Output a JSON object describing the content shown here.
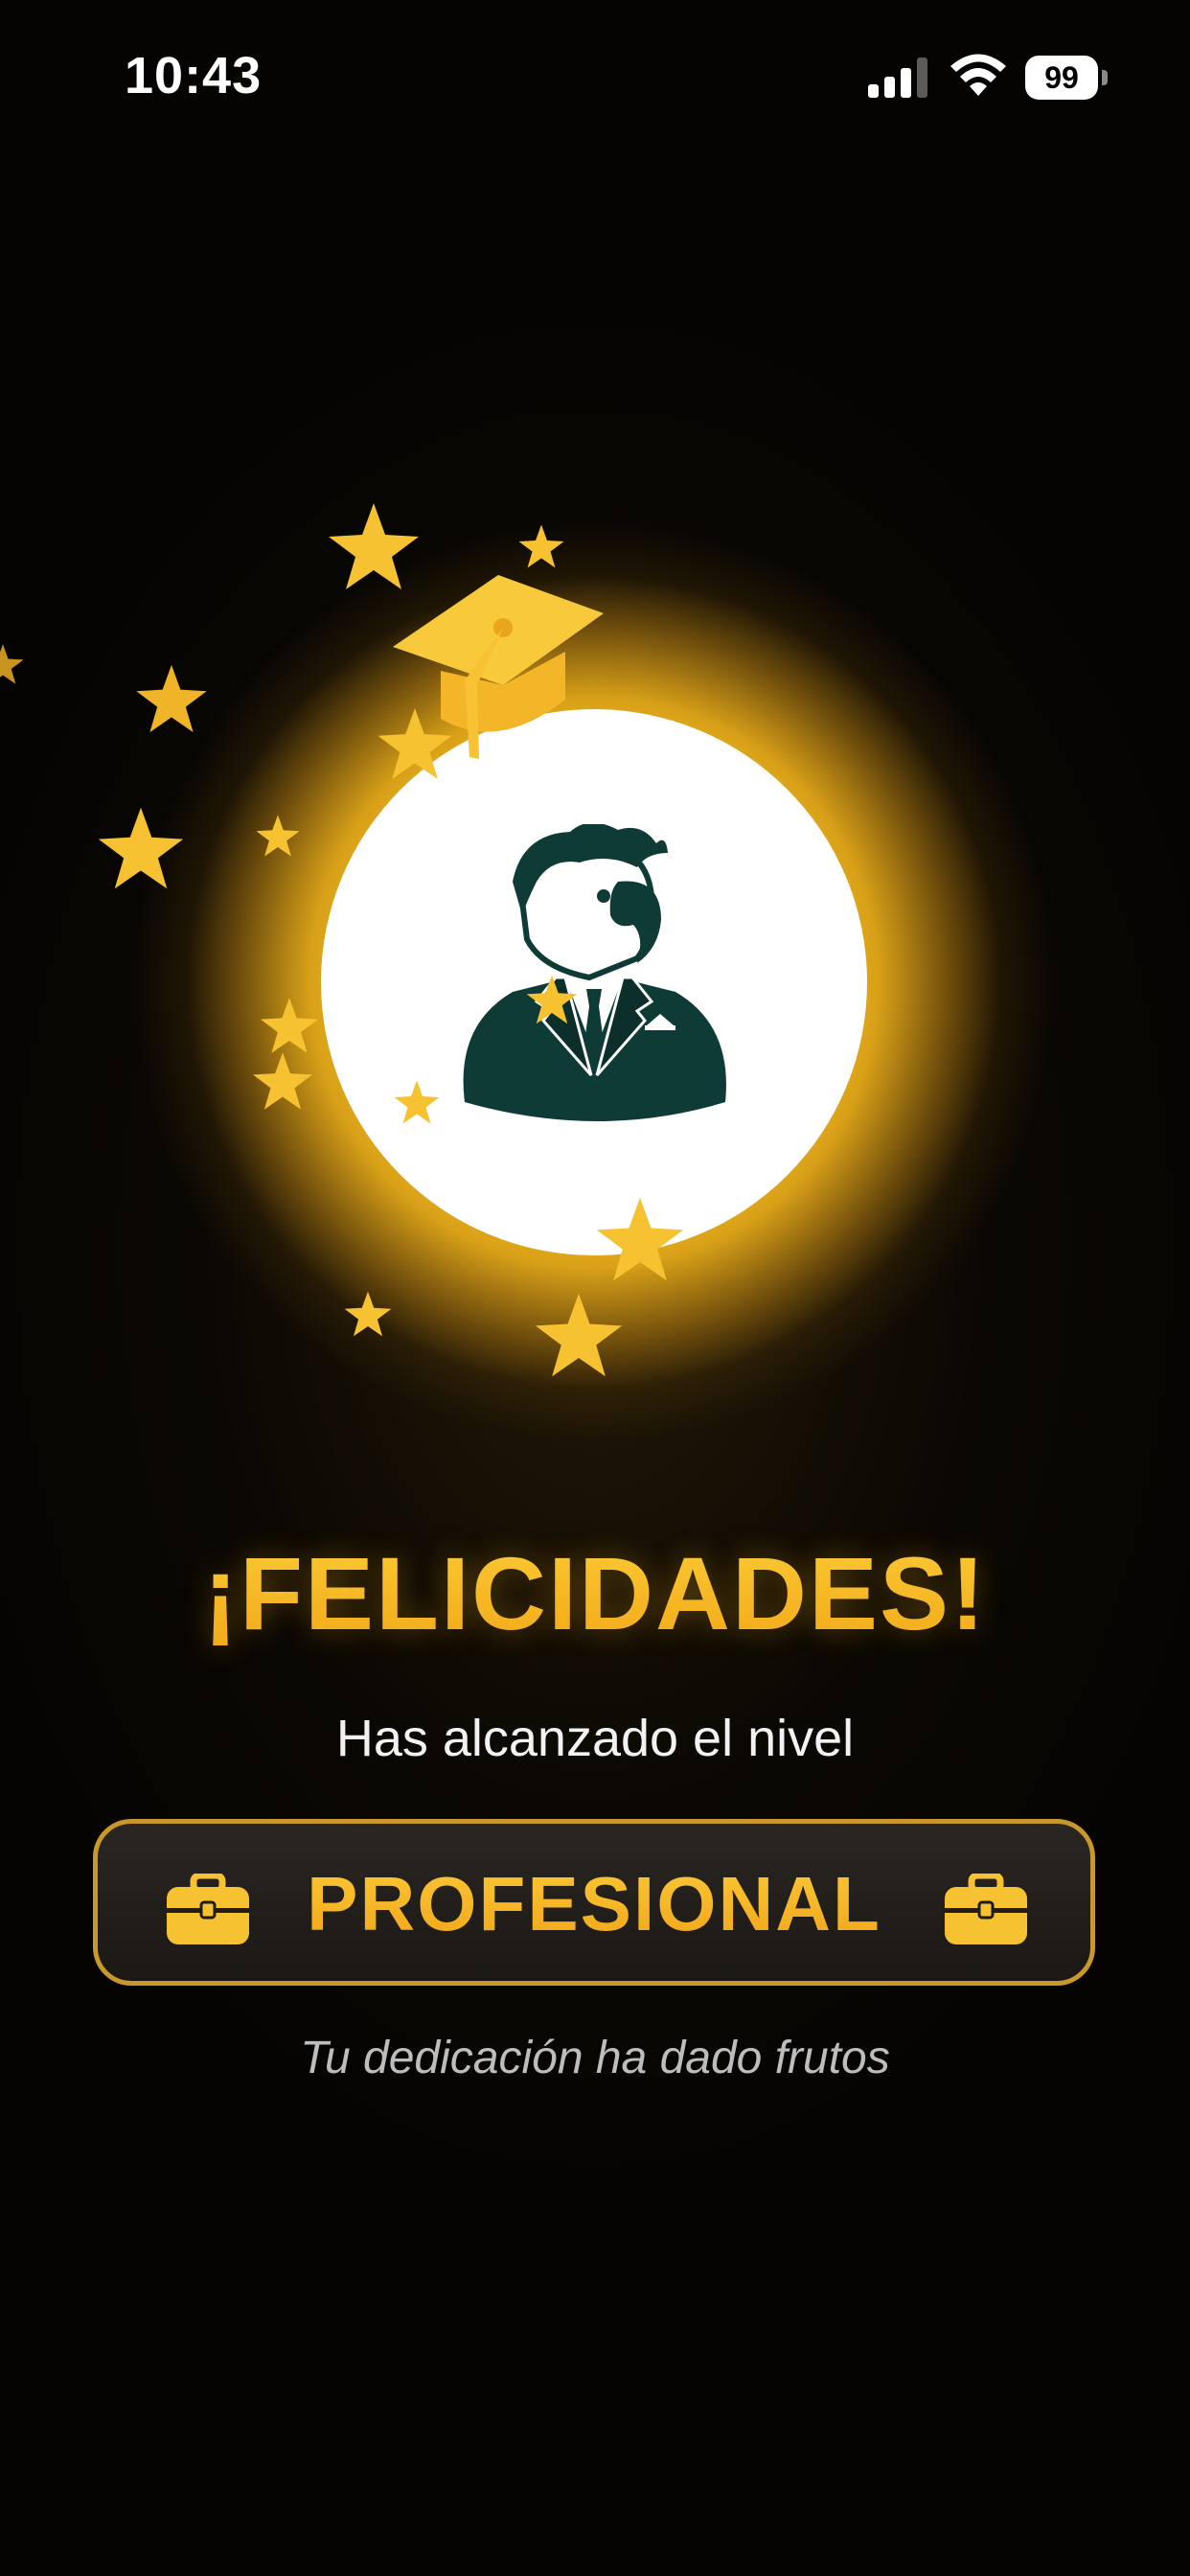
{
  "status_bar": {
    "time": "10:43",
    "battery": "99",
    "icons": [
      "cellular-signal-icon",
      "wifi-icon",
      "battery-icon"
    ]
  },
  "celebration": {
    "mascot": "parrot-in-suit-avatar",
    "decorations": [
      "graduation-cap-icon",
      "star-icon"
    ]
  },
  "headline": "¡FELICIDADES!",
  "subtitle": "Has alcanzado el nivel",
  "level": {
    "label": "PROFESIONAL",
    "icon": "briefcase-icon"
  },
  "tagline": "Tu dedicación ha dado frutos",
  "colors": {
    "background": "#050403",
    "gold": "#f4b41e",
    "card_border": "#c9982c",
    "card_bg": "#1f1c19",
    "mascot": "#0f3b37"
  }
}
